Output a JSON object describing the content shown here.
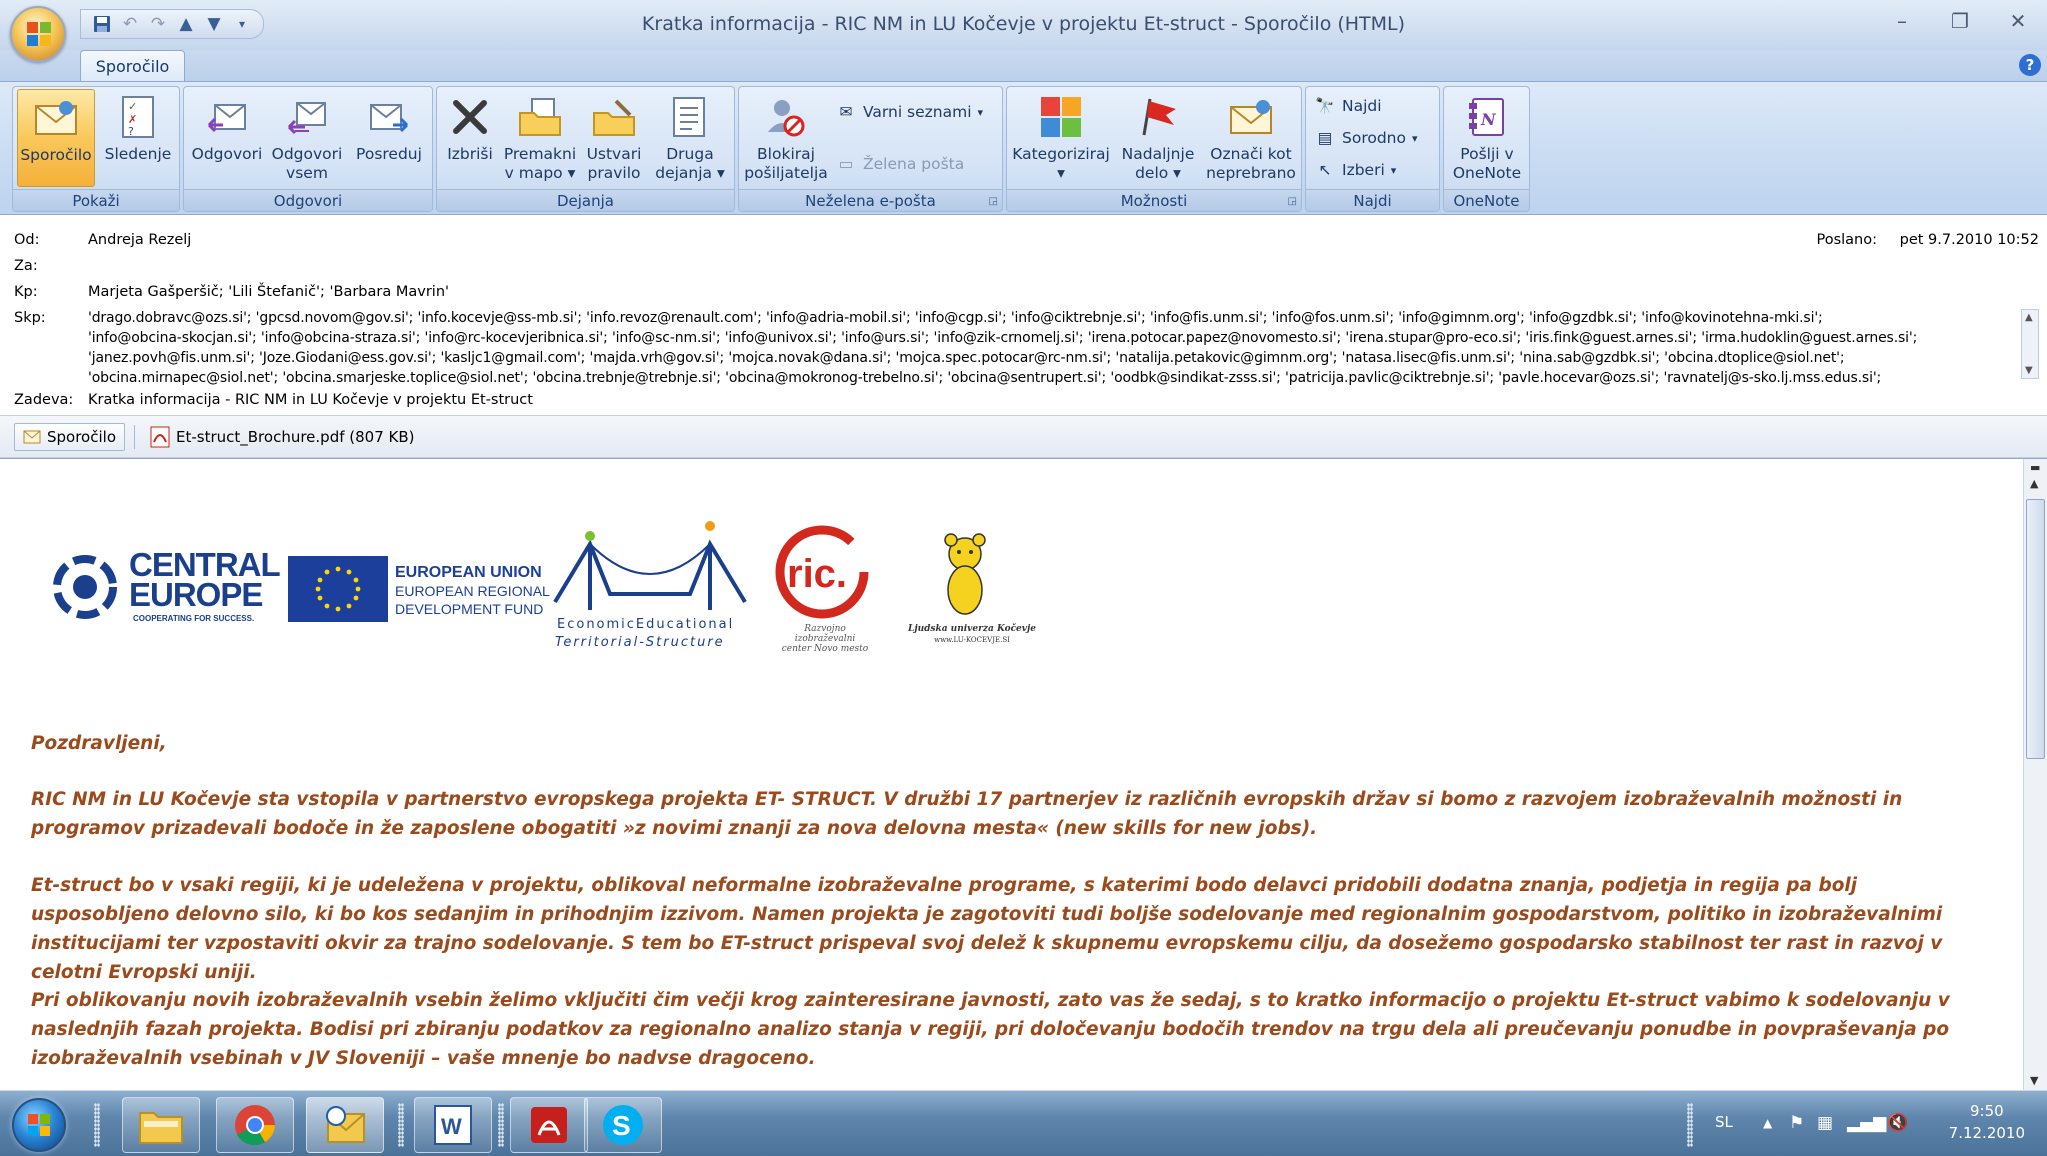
{
  "window": {
    "title": "Kratka informacija - RIC NM in LU Kočevje v  projektu Et-struct - Sporočilo (HTML)"
  },
  "ribbon": {
    "tab": "Sporočilo",
    "groups": {
      "pokazi": {
        "label": "Pokaži",
        "buttons": [
          "Sporočilo",
          "Sledenje"
        ]
      },
      "odgovori": {
        "label": "Odgovori",
        "buttons": [
          "Odgovori",
          "Odgovori vsem",
          "Posreduj"
        ]
      },
      "dejanja": {
        "label": "Dejanja",
        "buttons": [
          "Izbriši",
          "Premakni v mapo",
          "Ustvari pravilo",
          "Druga dejanja"
        ]
      },
      "nezelena": {
        "label": "Neželena e-pošta",
        "buttons": [
          "Blokiraj pošiljatelja",
          "Varni seznami",
          "Zelena pošta"
        ]
      },
      "moznosti": {
        "label": "Možnosti",
        "buttons": [
          "Kategoriziraj",
          "Nadaljnje delo",
          "Označi kot neprebrano"
        ]
      },
      "najdi": {
        "label": "Najdi",
        "buttons": [
          "Najdi",
          "Sorodno",
          "Izberi"
        ]
      },
      "onenote": {
        "label": "OneNote",
        "buttons": [
          "Pošlji v OneNote"
        ]
      }
    }
  },
  "header": {
    "od_label": "Od:",
    "od": "Andreja Rezelj",
    "za_label": "Za:",
    "za": "",
    "kp_label": "Kp:",
    "kp": "Marjeta Gašperšič; 'Lili Štefanič'; 'Barbara Mavrin'",
    "skp_label": "Skp:",
    "skp_lines": [
      "'drago.dobravc@ozs.si'; 'gpcsd.novom@gov.si'; 'info.kocevje@ss-mb.si'; 'info.revoz@renault.com'; 'info@adria-mobil.si'; 'info@cgp.si'; 'info@ciktrebnje.si'; 'info@fis.unm.si'; 'info@fos.unm.si'; 'info@gimnm.org'; 'info@gzdbk.si'; 'info@kovinotehna-mki.si';",
      "'info@obcina-skocjan.si'; 'info@obcina-straza.si'; 'info@rc-kocevjeribnica.si'; 'info@sc-nm.si'; 'info@univox.si'; 'info@urs.si'; 'info@zik-crnomelj.si'; 'irena.potocar.papez@novomesto.si'; 'irena.stupar@pro-eco.si'; 'iris.fink@guest.arnes.si'; 'irma.hudoklin@guest.arnes.si';",
      "'janez.povh@fis.unm.si'; 'Joze.Giodani@ess.gov.si'; 'kasljc1@gmail.com'; 'majda.vrh@gov.si'; 'mojca.novak@dana.si'; 'mojca.spec.potocar@rc-nm.si'; 'natalija.petakovic@gimnm.org'; 'natasa.lisec@fis.unm.si'; 'nina.sab@gzdbk.si'; 'obcina.dtoplice@siol.net';",
      "'obcina.mirnapec@siol.net'; 'obcina.smarjeske.toplice@siol.net'; 'obcina.trebnje@trebnje.si'; 'obcina@mokronog-trebelno.si'; 'obcina@sentrupert.si'; 'oodbk@sindikat-zsss.si'; 'patricija.pavlic@ciktrebnje.si'; 'pavle.hocevar@ozs.si'; 'ravnatelj@s-sko.lj.mss.edus.si';"
    ],
    "zadeva_label": "Zadeva:",
    "zadeva": "Kratka informacija - RIC NM in LU Kočevje v  projektu Et-struct",
    "poslano_label": "Poslano:",
    "poslano": "pet 9.7.2010 10:52"
  },
  "attachments": {
    "message_tab": "Sporočilo",
    "file": "Et-struct_Brochure.pdf (807 KB)"
  },
  "logos": {
    "central1": "CENTRAL",
    "central2": "EUROPE",
    "central_tag": "COOPERATING FOR SUCCESS.",
    "eu1": "EUROPEAN UNION",
    "eu2": "EUROPEAN REGIONAL",
    "eu3": "DEVELOPMENT FUND",
    "ees1": "EconomicEducational",
    "ees2": "Territorial-Structure",
    "ric": "ric.",
    "ric_sub1": "Razvojno izobraževalni",
    "ric_sub2": "center Novo mesto",
    "lu": "Ljudska univerza Kočevje",
    "lu_url": "www.LU-KOCEVJE.SI"
  },
  "body": {
    "greeting": "Pozdravljeni,",
    "p1": "RIC NM in LU Kočevje sta vstopila v partnerstvo evropskega projekta ET- STRUCT. V družbi 17 partnerjev iz različnih evropskih držav si bomo z razvojem izobraževalnih možnosti in programov prizadevali bodoče in že zaposlene obogatiti »z novimi znanji za nova delovna mesta« (new skills for new jobs).",
    "p2": "Et-struct bo v vsaki regiji, ki je udeležena v projektu, oblikoval neformalne izobraževalne programe, s katerimi bodo delavci pridobili dodatna znanja, podjetja in regija pa bolj usposobljeno delovno silo, ki bo kos sedanjim in prihodnjim izzivom. Namen projekta je zagotoviti tudi boljše sodelovanje med regionalnim gospodarstvom, politiko in izobraževalnimi institucijami ter vzpostaviti okvir za trajno sodelovanje. S tem bo ET-struct prispeval svoj delež k skupnemu evropskemu cilju, da dosežemo gospodarsko stabilnost ter rast in razvoj v celotni Evropski uniji.",
    "p3": "Pri oblikovanju novih izobraževalnih vsebin želimo vključiti čim večji krog zainteresirane javnosti, zato vas že sedaj, s to kratko informacijo o projektu Et-struct vabimo k sodelovanju v naslednjih fazah projekta. Bodisi pri zbiranju podatkov za regionalno analizo stanja v regiji, pri določevanju bodočih trendov na trgu dela ali preučevanju ponudbe in povpraševanja po izobraževalnih vsebinah v JV Sloveniji – vaše mnenje bo nadvse dragoceno."
  },
  "taskbar": {
    "lang": "SL",
    "time": "9:50",
    "date": "7.12.2010"
  },
  "colors": {
    "body_text": "#9b4a1c",
    "ribbon_bg": "#c8dbf2",
    "ric_red": "#d2281e",
    "lu_yellow": "#f4d21f"
  }
}
